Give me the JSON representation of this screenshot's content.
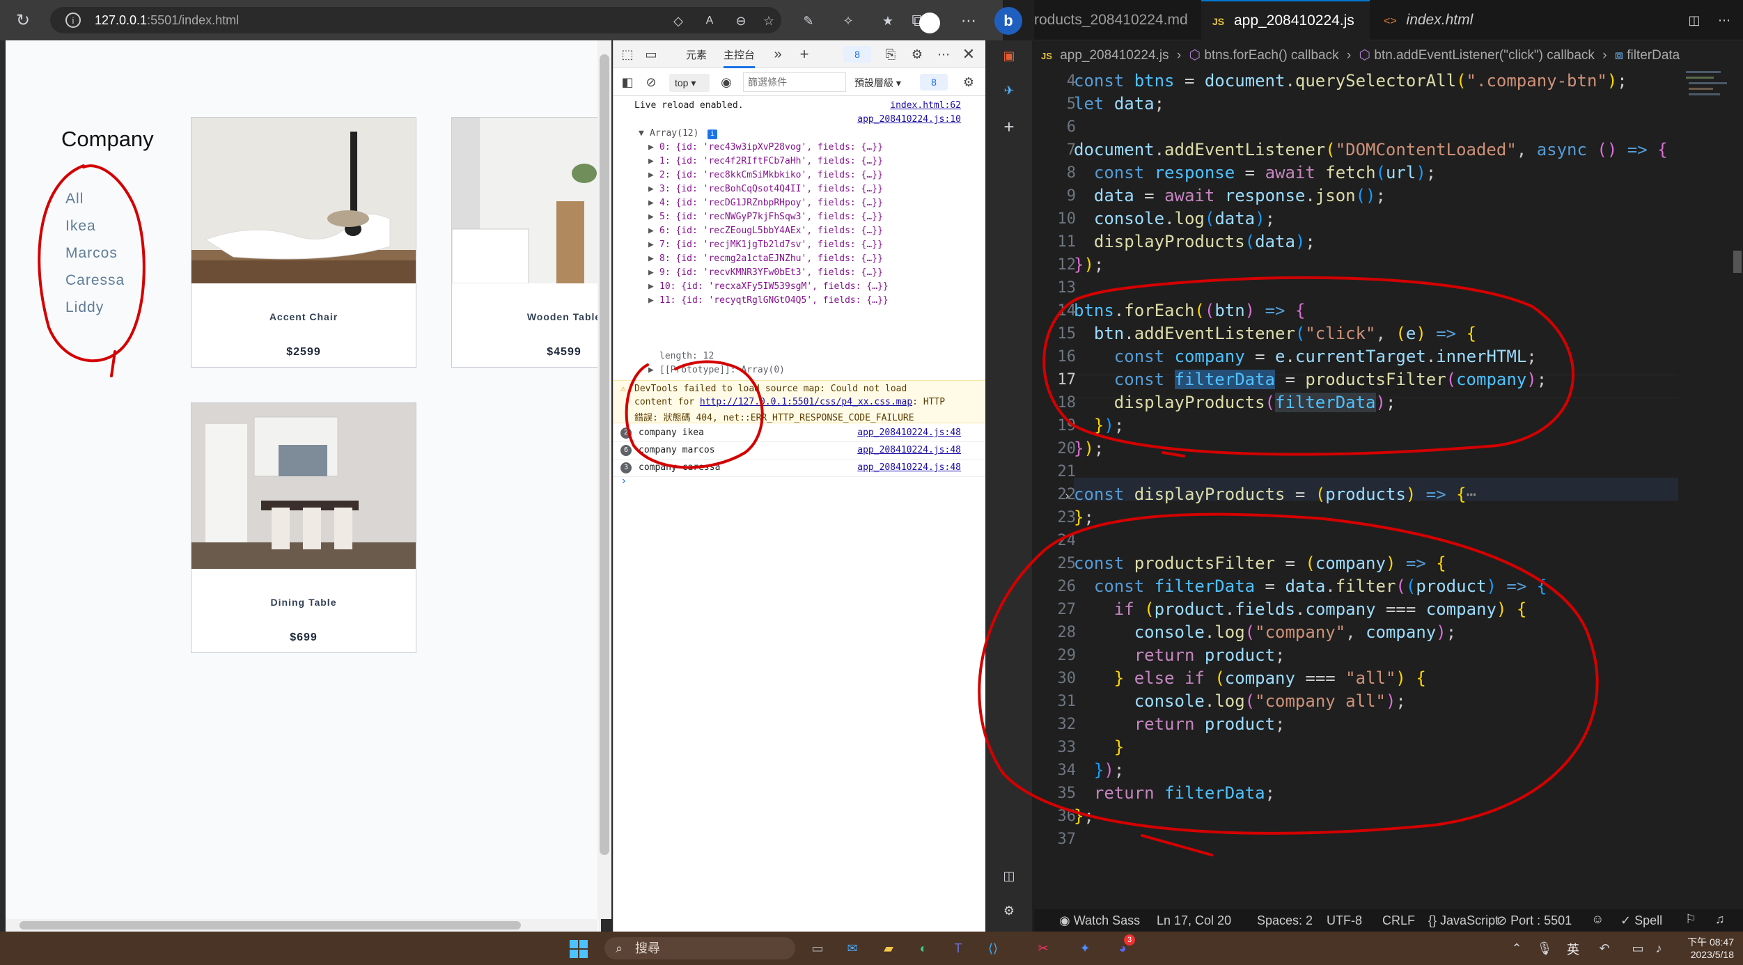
{
  "browser": {
    "url_host": "127.0.0.1",
    "url_rest": ":5501/index.html"
  },
  "page": {
    "heading": "Company",
    "companies": [
      "All",
      "Ikea",
      "Marcos",
      "Caressa",
      "Liddy"
    ],
    "products": [
      {
        "name": "Accent Chair",
        "price": "$2599"
      },
      {
        "name": "Wooden Table",
        "price": "$4599"
      },
      {
        "name": "Dining Table",
        "price": "$699"
      }
    ]
  },
  "devtools": {
    "tab_elements": "元素",
    "tab_console": "主控台",
    "issues_count": "8",
    "context": "top",
    "filter_placeholder": "篩選條件",
    "levels": "預設層級",
    "levels_count": "8",
    "live_reload": "Live reload enabled.",
    "live_reload_src": "index.html:62",
    "log_src": "app_208410224.js:10",
    "array_label": "Array(12)",
    "array_items": [
      "0: {id: 'rec43w3ipXvP28vog', fields: {…}}",
      "1: {id: 'rec4f2RIftFCb7aHh', fields: {…}}",
      "2: {id: 'rec8kkCmSiMkbkiko', fields: {…}}",
      "3: {id: 'recBohCqQsot4Q4II', fields: {…}}",
      "4: {id: 'recDG1JRZnbpRHpoy', fields: {…}}",
      "5: {id: 'recNWGyP7kjFhSqw3', fields: {…}}",
      "6: {id: 'recZEougL5bbY4AEx', fields: {…}}",
      "7: {id: 'recjMK1jgTb2ld7sv', fields: {…}}",
      "8: {id: 'recmg2a1ctaEJNZhu', fields: {…}}",
      "9: {id: 'recvKMNR3YFw0bEt3', fields: {…}}",
      "10: {id: 'recxaXFy5IW539sgM', fields: {…}}",
      "11: {id: 'recyqtRglGNGtO4Q5', fields: {…}}"
    ],
    "length": "length: 12",
    "prototype": "[[Prototype]]: Array(0)",
    "warning_line1": "DevTools failed to load source map: Could not load",
    "warning_line2a": "content for ",
    "warning_url": "http://127.0.0.1:5501/css/p4_xx.css.map",
    "warning_line2b": ": HTTP",
    "warning_line3": "錯誤: 狀態碼 404, net::ERR_HTTP_RESPONSE_CODE_FAILURE",
    "logs": [
      {
        "count": "2",
        "text": "company ikea",
        "src": "app_208410224.js:48"
      },
      {
        "count": "6",
        "text": "company marcos",
        "src": "app_208410224.js:48"
      },
      {
        "count": "3",
        "text": "company caressa",
        "src": "app_208410224.js:48"
      }
    ]
  },
  "vscode": {
    "tabs": [
      {
        "label": "roducts_208410224.md"
      },
      {
        "label": "app_208410224.js",
        "badge": "JS"
      },
      {
        "label": "index.html",
        "badge": "<>"
      }
    ],
    "breadcrumb": [
      "app_208410224.js",
      "btns.forEach() callback",
      "btn.addEventListener(\"click\") callback",
      "filterData"
    ],
    "breadcrumb_js": "JS",
    "line_numbers": [
      "4",
      "5",
      "6",
      "7",
      "8",
      "9",
      "10",
      "11",
      "12",
      "13",
      "14",
      "15",
      "16",
      "17",
      "18",
      "19",
      "20",
      "21",
      "22",
      "23",
      "24",
      "25",
      "26",
      "27",
      "28",
      "29",
      "30",
      "31",
      "32",
      "33",
      "34",
      "35",
      "36",
      "37"
    ],
    "status": {
      "watch_sass": "Watch Sass",
      "position": "Ln 17, Col 20",
      "spaces": "Spaces: 2",
      "encoding": "UTF-8",
      "eol": "CRLF",
      "language": "JavaScript",
      "port": "Port : 5501",
      "spell": "Spell"
    }
  },
  "taskbar": {
    "search": "搜尋",
    "lang": "英",
    "time": "下午 08:47",
    "date": "2023/5/18",
    "badge": "3"
  },
  "colors": {
    "annotation": "#d40000",
    "accent": "#007acc",
    "devtools_blue": "#1a73e8"
  }
}
